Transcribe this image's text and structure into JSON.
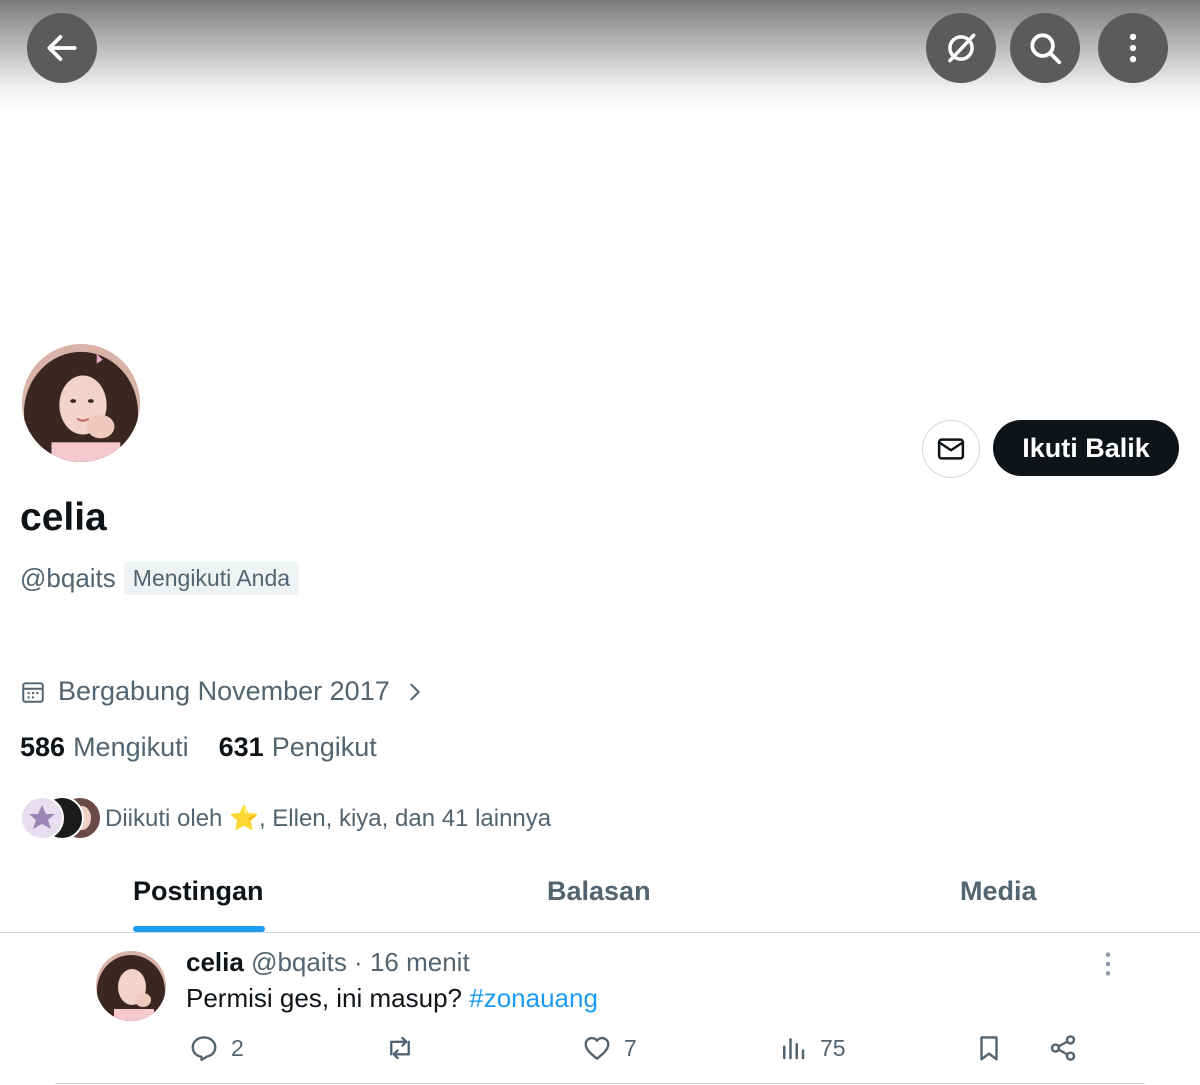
{
  "profile": {
    "name": "celia",
    "handle": "@bqaits",
    "follows_you": "Mengikuti Anda",
    "joined": "Bergabung November 2017",
    "following_count": "586",
    "following_label": "Mengikuti",
    "followers_count": "631",
    "followers_label": "Pengikut",
    "followed_by": "Diikuti oleh ⭐, Ellen, kiya, dan 41 lainnya",
    "follow_button": "Ikuti Balik"
  },
  "tabs": [
    {
      "label": "Postingan",
      "active": true
    },
    {
      "label": "Balasan",
      "active": false
    },
    {
      "label": "Media",
      "active": false
    }
  ],
  "post": {
    "author": "celia",
    "meta": "@bqaits · 16 menit",
    "text": "Permisi ges, ini masup? ",
    "hashtag": "#zonauang",
    "replies": "2",
    "likes": "7",
    "views": "75"
  },
  "colors": {
    "accent": "#1d9bf0",
    "primary_text": "#0f1419",
    "secondary_text": "#536471",
    "button_dark": "#0f1419",
    "overlay_button": "#5b5b5b"
  },
  "icons": {
    "back": "arrow-left-icon",
    "grok": "grok-icon",
    "search": "search-icon",
    "more": "more-vertical-icon",
    "message": "envelope-icon",
    "calendar": "calendar-icon",
    "reply": "reply-icon",
    "repost": "repost-icon",
    "like": "heart-icon",
    "views": "views-icon",
    "bookmark": "bookmark-icon",
    "share": "share-icon"
  }
}
